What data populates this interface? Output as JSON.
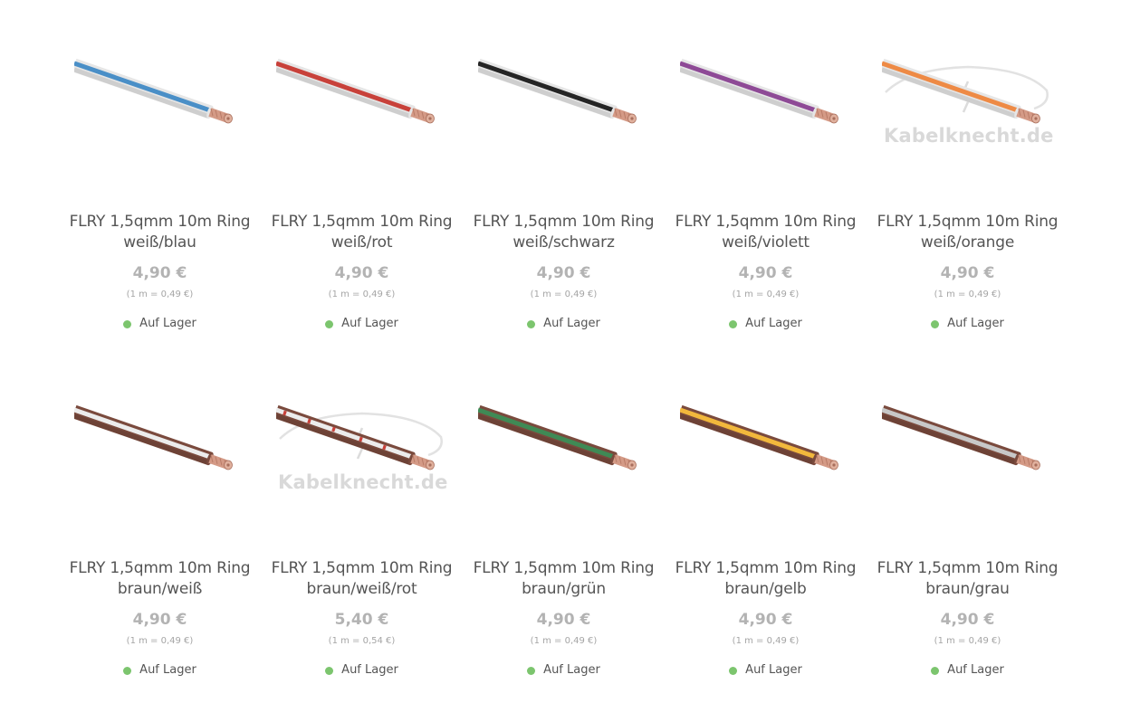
{
  "products": [
    {
      "title_line1": "FLRY 1,5qmm 10m Ring",
      "title_line2": "weiß/blau",
      "price": "4,90 €",
      "unit_price": "(1 m = 0,49 €)",
      "stock": "Auf Lager",
      "base_color": "#e6e6e6",
      "stripe_color": "#4a8fc7",
      "watermark": ""
    },
    {
      "title_line1": "FLRY 1,5qmm 10m Ring",
      "title_line2": "weiß/rot",
      "price": "4,90 €",
      "unit_price": "(1 m = 0,49 €)",
      "stock": "Auf Lager",
      "base_color": "#e6e6e6",
      "stripe_color": "#c8413a",
      "watermark": ""
    },
    {
      "title_line1": "FLRY 1,5qmm 10m Ring",
      "title_line2": "weiß/schwarz",
      "price": "4,90 €",
      "unit_price": "(1 m = 0,49 €)",
      "stock": "Auf Lager",
      "base_color": "#e6e6e6",
      "stripe_color": "#252525",
      "watermark": ""
    },
    {
      "title_line1": "FLRY 1,5qmm 10m Ring",
      "title_line2": "weiß/violett",
      "price": "4,90 €",
      "unit_price": "(1 m = 0,49 €)",
      "stock": "Auf Lager",
      "base_color": "#e6e6e6",
      "stripe_color": "#8e4a96",
      "watermark": ""
    },
    {
      "title_line1": "FLRY 1,5qmm 10m Ring",
      "title_line2": "weiß/orange",
      "price": "4,90 €",
      "unit_price": "(1 m = 0,49 €)",
      "stock": "Auf Lager",
      "base_color": "#e6e6e6",
      "stripe_color": "#ee8a45",
      "watermark": "Kabelknecht.de"
    },
    {
      "title_line1": "FLRY 1,5qmm 10m Ring",
      "title_line2": "braun/weiß",
      "price": "4,90 €",
      "unit_price": "(1 m = 0,49 €)",
      "stock": "Auf Lager",
      "base_color": "#7a4a3d",
      "stripe_color": "#ececec",
      "watermark": ""
    },
    {
      "title_line1": "FLRY 1,5qmm 10m Ring",
      "title_line2": "braun/weiß/rot",
      "price": "5,40 €",
      "unit_price": "(1 m = 0,54 €)",
      "stock": "Auf Lager",
      "base_color": "#7a4a3d",
      "stripe_color": "#ececec",
      "watermark": "Kabelknecht.de"
    },
    {
      "title_line1": "FLRY 1,5qmm 10m Ring",
      "title_line2": "braun/grün",
      "price": "4,90 €",
      "unit_price": "(1 m = 0,49 €)",
      "stock": "Auf Lager",
      "base_color": "#7a4a3d",
      "stripe_color": "#3f8a55",
      "watermark": ""
    },
    {
      "title_line1": "FLRY 1,5qmm 10m Ring",
      "title_line2": "braun/gelb",
      "price": "4,90 €",
      "unit_price": "(1 m = 0,49 €)",
      "stock": "Auf Lager",
      "base_color": "#7a4a3d",
      "stripe_color": "#f2b83c",
      "watermark": ""
    },
    {
      "title_line1": "FLRY 1,5qmm 10m Ring",
      "title_line2": "braun/grau",
      "price": "4,90 €",
      "unit_price": "(1 m = 0,49 €)",
      "stock": "Auf Lager",
      "base_color": "#7a4a3d",
      "stripe_color": "#c8c8c8",
      "watermark": ""
    }
  ],
  "colors": {
    "price": "#b3b3b3",
    "stock_dot": "#7cc56e",
    "copper": "#d49a86"
  },
  "icons": {
    "wire_image": "cable-wire-image",
    "stock": "in-stock-dot-icon"
  }
}
